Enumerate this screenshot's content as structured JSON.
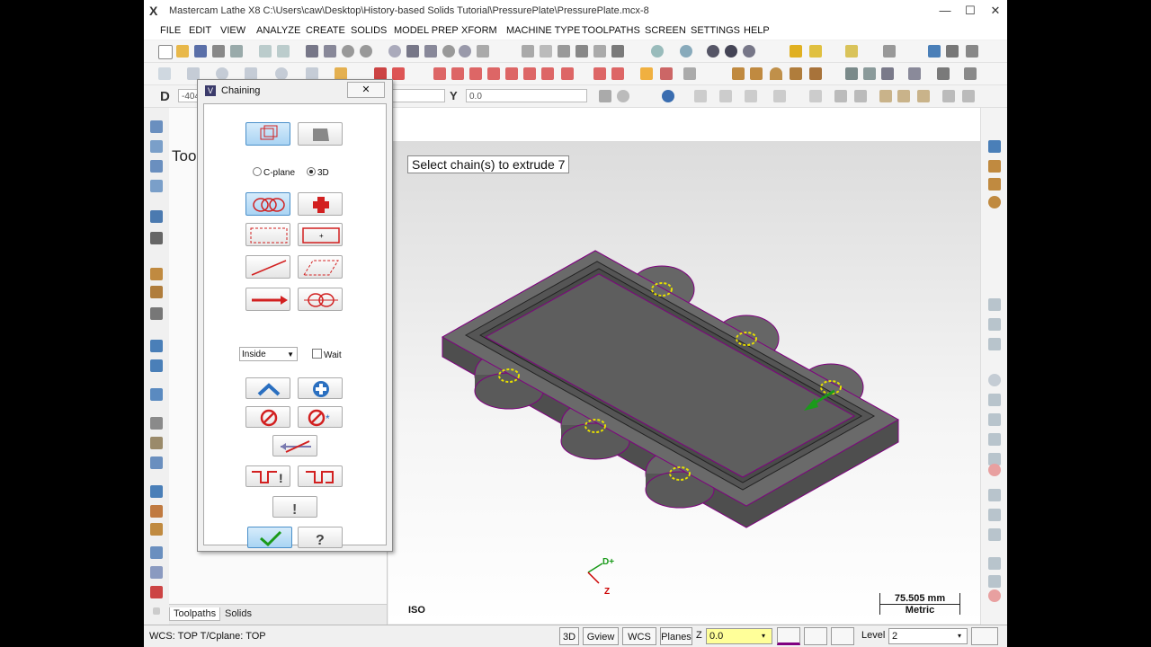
{
  "window": {
    "title": "Mastercam Lathe X8  C:\\Users\\caw\\Desktop\\History-based Solids Tutorial\\PressurePlate\\PressurePlate.mcx-8",
    "logo": "X",
    "minimize": "—",
    "maximize": "☐",
    "close": "✕"
  },
  "menu": [
    "FILE",
    "EDIT",
    "VIEW",
    "ANALYZE",
    "CREATE",
    "SOLIDS",
    "MODEL PREP",
    "XFORM",
    "MACHINE TYPE",
    "TOOLPATHS",
    "SCREEN",
    "SETTINGS",
    "HELP"
  ],
  "ribbon": {
    "d_label": "D",
    "d_value": "-404",
    "y_label": "Y",
    "y_value": "0.0"
  },
  "manager": {
    "title": "Tool",
    "tabs": [
      "Toolpaths",
      "Solids"
    ]
  },
  "dialog": {
    "title": "Chaining",
    "logo": "V",
    "close": "✕",
    "cplane_label": "C-plane",
    "threed_label": "3D",
    "mode_value": "Inside",
    "wait_label": "Wait"
  },
  "viewport": {
    "prompt": "Select chain(s) to extrude 7",
    "view_name": "ISO",
    "scale_value": "75.505 mm",
    "scale_unit": "Metric",
    "axis_d": "D+",
    "axis_z": "Z"
  },
  "status": {
    "wcs_text": "WCS: TOP  T/Cplane: TOP",
    "btn_3d": "3D",
    "btn_gview": "Gview",
    "btn_wcs": "WCS",
    "btn_planes": "Planes",
    "z_label": "Z",
    "z_value": "0.0",
    "level_label": "Level",
    "level_value": "2"
  },
  "colors": {
    "accent_blue": "#4a8fc9",
    "chain_red": "#d22020",
    "part_edge": "#800080",
    "part_fill": "#6a6a6a"
  }
}
